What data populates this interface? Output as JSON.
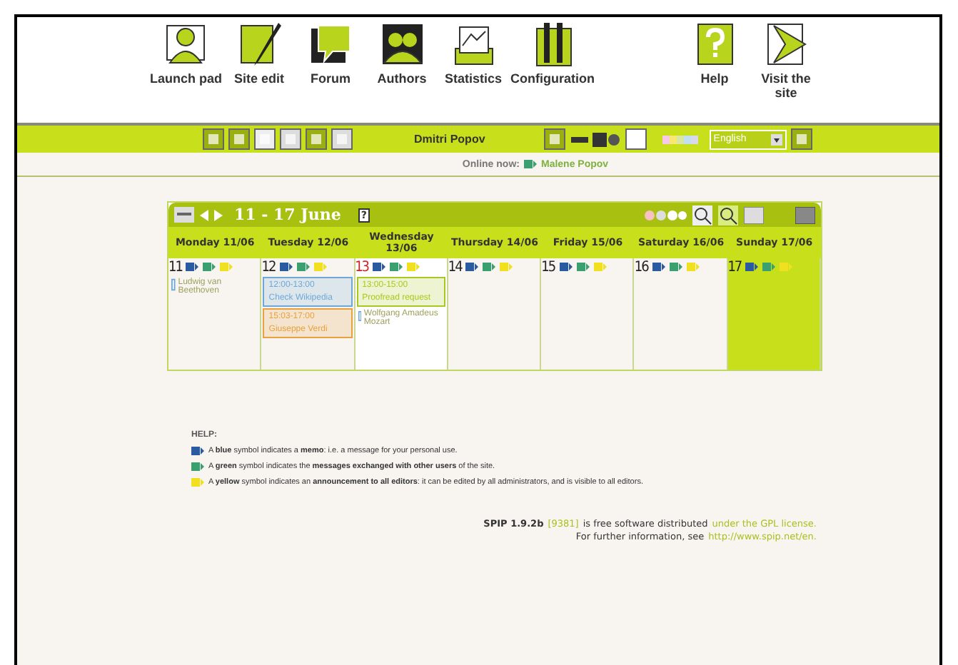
{
  "nav": {
    "main": [
      {
        "label": "Launch pad"
      },
      {
        "label": "Site edit"
      },
      {
        "label": "Forum"
      },
      {
        "label": "Authors"
      },
      {
        "label": "Statistics"
      },
      {
        "label": "Configuration"
      }
    ],
    "side": [
      {
        "label": "Help"
      },
      {
        "label": "Visit the site"
      }
    ]
  },
  "toolbar": {
    "user": "Dmitri Popov",
    "language": "English"
  },
  "online": {
    "label": "Online now:",
    "user": "Malene Popov"
  },
  "calendar": {
    "title": "11 - 17 June",
    "help_key": "?",
    "days": [
      {
        "header": "Monday 11/06",
        "number": "11",
        "today": false,
        "weekend": false,
        "events": [
          {
            "kind": "author",
            "title": "Ludwig van Beethoven"
          }
        ]
      },
      {
        "header": "Tuesday 12/06",
        "number": "12",
        "today": false,
        "weekend": false,
        "events": [
          {
            "kind": "event",
            "time": "12:00-13:00",
            "title": "Check Wikipedia",
            "color": "#6fa8d8"
          },
          {
            "kind": "event",
            "time": "15:03-17:00",
            "title": "Giuseppe Verdi",
            "color": "#e8a040"
          }
        ]
      },
      {
        "header": "Wednesday 13/06",
        "number": "13",
        "today": true,
        "weekend": false,
        "events": [
          {
            "kind": "event",
            "time": "13:00-15:00",
            "title": "Proofread request",
            "color": "#a8c820"
          },
          {
            "kind": "author",
            "title": "Wolfgang Amadeus Mozart"
          }
        ]
      },
      {
        "header": "Thursday 14/06",
        "number": "14",
        "today": false,
        "weekend": false
      },
      {
        "header": "Friday 15/06",
        "number": "15",
        "today": false,
        "weekend": false
      },
      {
        "header": "Saturday 16/06",
        "number": "16",
        "today": false,
        "weekend": false
      },
      {
        "header": "Sunday 17/06",
        "number": "17",
        "today": false,
        "weekend": true
      }
    ]
  },
  "help": {
    "title": "HELP:",
    "items": [
      {
        "color": "#2a5aa0",
        "text": "A **blue** symbol indicates a **memo**: i.e. a message for your personal use."
      },
      {
        "color": "#3aa070",
        "text": "A **green** symbol indicates the **messages exchanged with other users** of the site."
      },
      {
        "color": "#f0e020",
        "text": "A **yellow** symbol indicates an **announcement to all editors**: it can be edited by all administrators, and is visible to all editors."
      }
    ]
  },
  "footer": {
    "product": "SPIP 1.9.2b",
    "revision": "[9381]",
    "text": "is free software distributed",
    "license": "under the GPL license.",
    "info": "For further information, see",
    "url": "http://www.spip.net/en."
  }
}
